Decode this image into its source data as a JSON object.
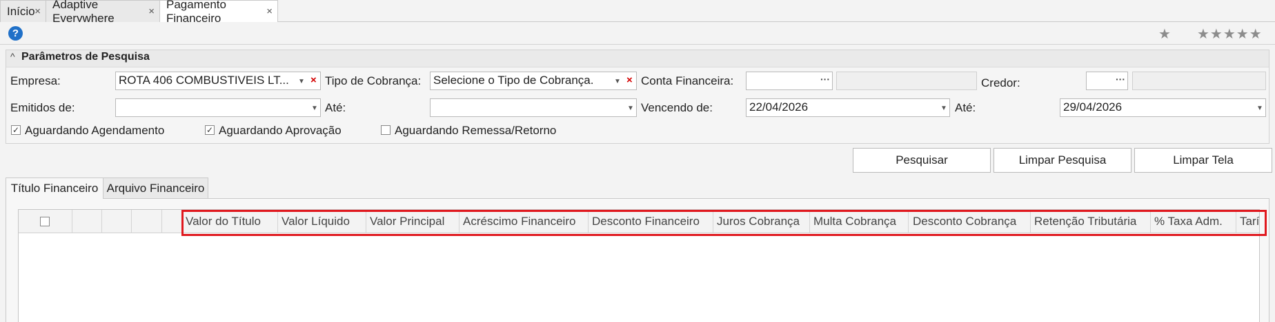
{
  "tabs": [
    {
      "label": "Início"
    },
    {
      "label": "Adaptive Everywhere"
    },
    {
      "label": "Pagamento Financeiro"
    }
  ],
  "toolbar": {
    "help": "?",
    "favorite": "★",
    "rating": "★★★★★"
  },
  "panel": {
    "title": "Parâmetros de Pesquisa",
    "chevron": "^",
    "empresa_label": "Empresa:",
    "empresa_value": "ROTA 406 COMBUSTIVEIS LT...",
    "tipo_label": "Tipo de Cobrança:",
    "tipo_value": "Selecione o Tipo de Cobrança.",
    "conta_label": "Conta Financeira:",
    "conta_dots": "···",
    "credor_label": "Credor:",
    "credor_dots": "···",
    "emitidos_label": "Emitidos de:",
    "ate1_label": "Até:",
    "vencendo_label": "Vencendo de:",
    "vencendo_value": "22/04/2026",
    "ate2_label": "Até:",
    "ate2_value": "29/04/2026",
    "chk1_label": "Aguardando Agendamento",
    "chk2_label": "Aguardando Aprovação",
    "chk3_label": "Aguardando Remessa/Retorno"
  },
  "buttons": {
    "pesquisar": "Pesquisar",
    "limpar_pesquisa": "Limpar Pesquisa",
    "limpar_tela": "Limpar Tela"
  },
  "inner_tabs": [
    {
      "label": "Título Financeiro"
    },
    {
      "label": "Arquivo Financeiro"
    }
  ],
  "grid": {
    "columns": [
      "Valor do Título",
      "Valor Líquido",
      "Valor Principal",
      "Acréscimo Financeiro",
      "Desconto Financeiro",
      "Juros Cobrança",
      "Multa Cobrança",
      "Desconto Cobrança",
      "Retenção Tributária",
      "% Taxa Adm.",
      "Tarí"
    ]
  },
  "colors": {
    "highlight": "#e0181e",
    "help": "#1f70c8",
    "clear": "#d40000"
  }
}
